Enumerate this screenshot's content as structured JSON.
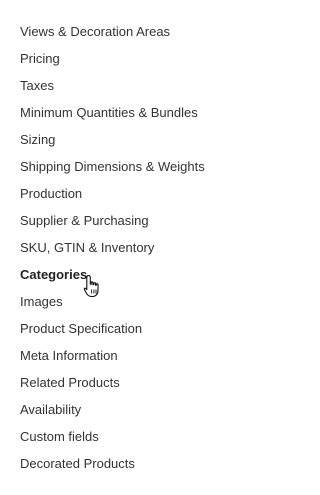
{
  "nav": {
    "items": [
      {
        "label": "Views & Decoration Areas",
        "active": false
      },
      {
        "label": "Pricing",
        "active": false
      },
      {
        "label": "Taxes",
        "active": false
      },
      {
        "label": "Minimum Quantities & Bundles",
        "active": false
      },
      {
        "label": "Sizing",
        "active": false
      },
      {
        "label": "Shipping Dimensions & Weights",
        "active": false
      },
      {
        "label": "Production",
        "active": false
      },
      {
        "label": "Supplier & Purchasing",
        "active": false
      },
      {
        "label": "SKU, GTIN & Inventory",
        "active": false
      },
      {
        "label": "Categories",
        "active": true
      },
      {
        "label": "Images",
        "active": false
      },
      {
        "label": "Product Specification",
        "active": false
      },
      {
        "label": "Meta Information",
        "active": false
      },
      {
        "label": "Related Products",
        "active": false
      },
      {
        "label": "Availability",
        "active": false
      },
      {
        "label": "Custom fields",
        "active": false
      },
      {
        "label": "Decorated Products",
        "active": false
      }
    ]
  },
  "cursor": {
    "icon": "hand-pointer-icon"
  }
}
